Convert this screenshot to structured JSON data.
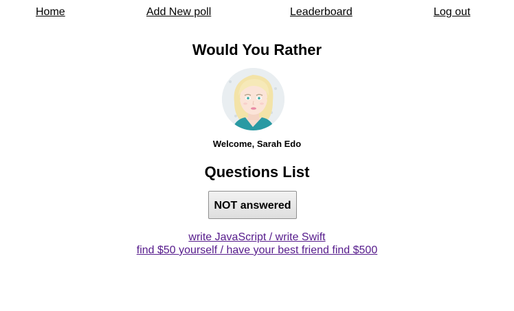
{
  "nav": {
    "home": "Home",
    "add_poll": "Add New poll",
    "leaderboard": "Leaderboard",
    "logout": "Log out"
  },
  "app_title": "Would You Rather",
  "user": {
    "welcome": "Welcome, Sarah Edo",
    "avatar_icon": "user-avatar-icon"
  },
  "questions_heading": "Questions List",
  "filter_button": "NOT answered",
  "questions": [
    "write JavaScript / write Swift",
    "find $50 yourself / have your best friend find $500"
  ],
  "colors": {
    "visited_link": "#551a8b",
    "nav_link": "#000000"
  }
}
